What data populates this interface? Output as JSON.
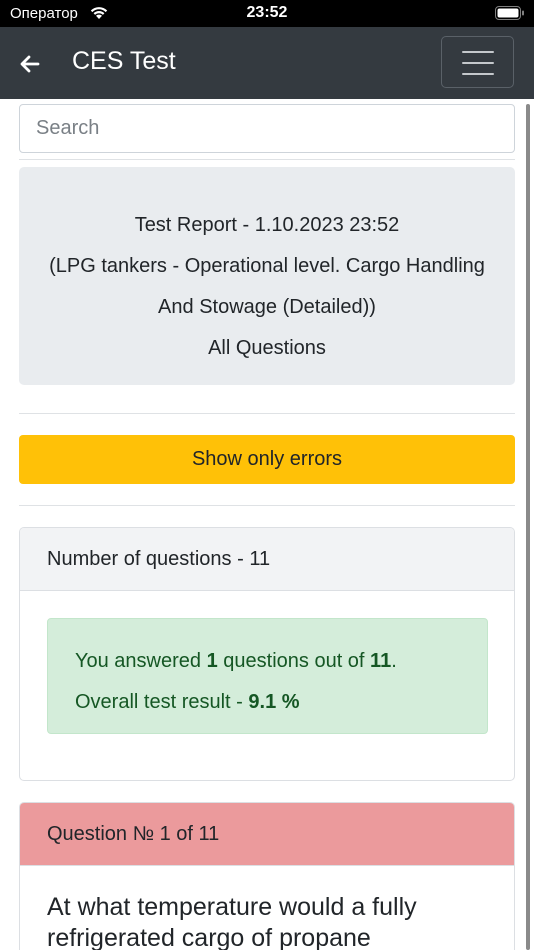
{
  "status_bar": {
    "carrier": "Оператор",
    "time": "23:52"
  },
  "navbar": {
    "title": "CES Test",
    "back_icon": "arrow-left-icon",
    "menu_icon": "hamburger-menu-icon"
  },
  "search": {
    "placeholder": "Search"
  },
  "report": {
    "title": "Test Report - 1.10.2023 23:52",
    "course_line1": "(LPG tankers - Operational level. Cargo Handling",
    "course_line2": "And Stowage (Detailed))",
    "scope": "All Questions"
  },
  "errors_button": {
    "label": "Show only errors",
    "color": "#ffc107"
  },
  "summary": {
    "header": "Number of questions - 11",
    "answered_prefix": "You answered ",
    "answered_count": "1",
    "answered_middle": " questions out of ",
    "total": "11",
    "answered_suffix": ".",
    "result_prefix": "Overall test result - ",
    "result_value": "9.1 %"
  },
  "question": {
    "header": "Question № 1 of 11",
    "text": "At what temperature would a fully refrigerated cargo of propane",
    "header_color": "#eb9a9c"
  }
}
